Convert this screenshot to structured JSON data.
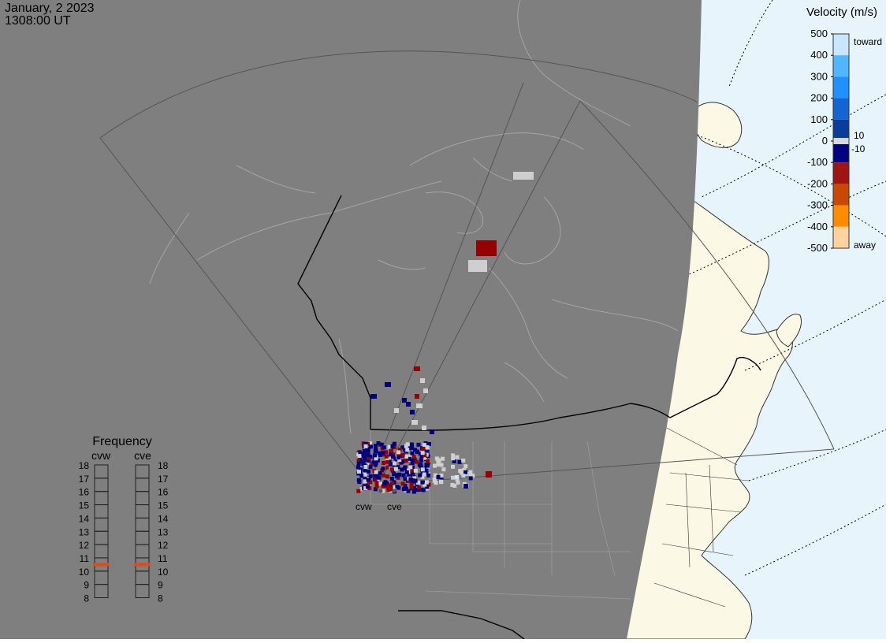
{
  "header": {
    "date": "January, 2 2023",
    "time": "1308:00 UT"
  },
  "velocity_scale": {
    "title": "Velocity (m/s)",
    "ticks": [
      "500",
      "400",
      "300",
      "200",
      "100",
      "0",
      "-100",
      "-200",
      "-300",
      "-400",
      "-500"
    ],
    "toward_label": "toward",
    "away_label": "away",
    "gap_upper_label": "10",
    "gap_lower_label": "-10",
    "colors": [
      "#c8e6ff",
      "#4fb6ff",
      "#1e90ff",
      "#1464d2",
      "#0a3c9c",
      "#000080",
      "#7d0000",
      "#a01414",
      "#c84a00",
      "#ff8c00",
      "#ffd2a0"
    ]
  },
  "frequency_panel": {
    "title": "Frequency",
    "radars": [
      {
        "label": "cvw",
        "current_mhz": 10.5
      },
      {
        "label": "cve",
        "current_mhz": 10.5
      }
    ],
    "ticks": [
      "18",
      "17",
      "16",
      "15",
      "14",
      "13",
      "12",
      "11",
      "10",
      "9",
      "8"
    ]
  },
  "radar_sites": [
    "cvw",
    "cve"
  ],
  "colors": {
    "night": "#7f7f7f",
    "land_day": "#fbf8e6",
    "ocean_day": "#e8f4fc",
    "frequency_marker": "#e34a17",
    "ground_scatter": "#cfcfcf"
  }
}
